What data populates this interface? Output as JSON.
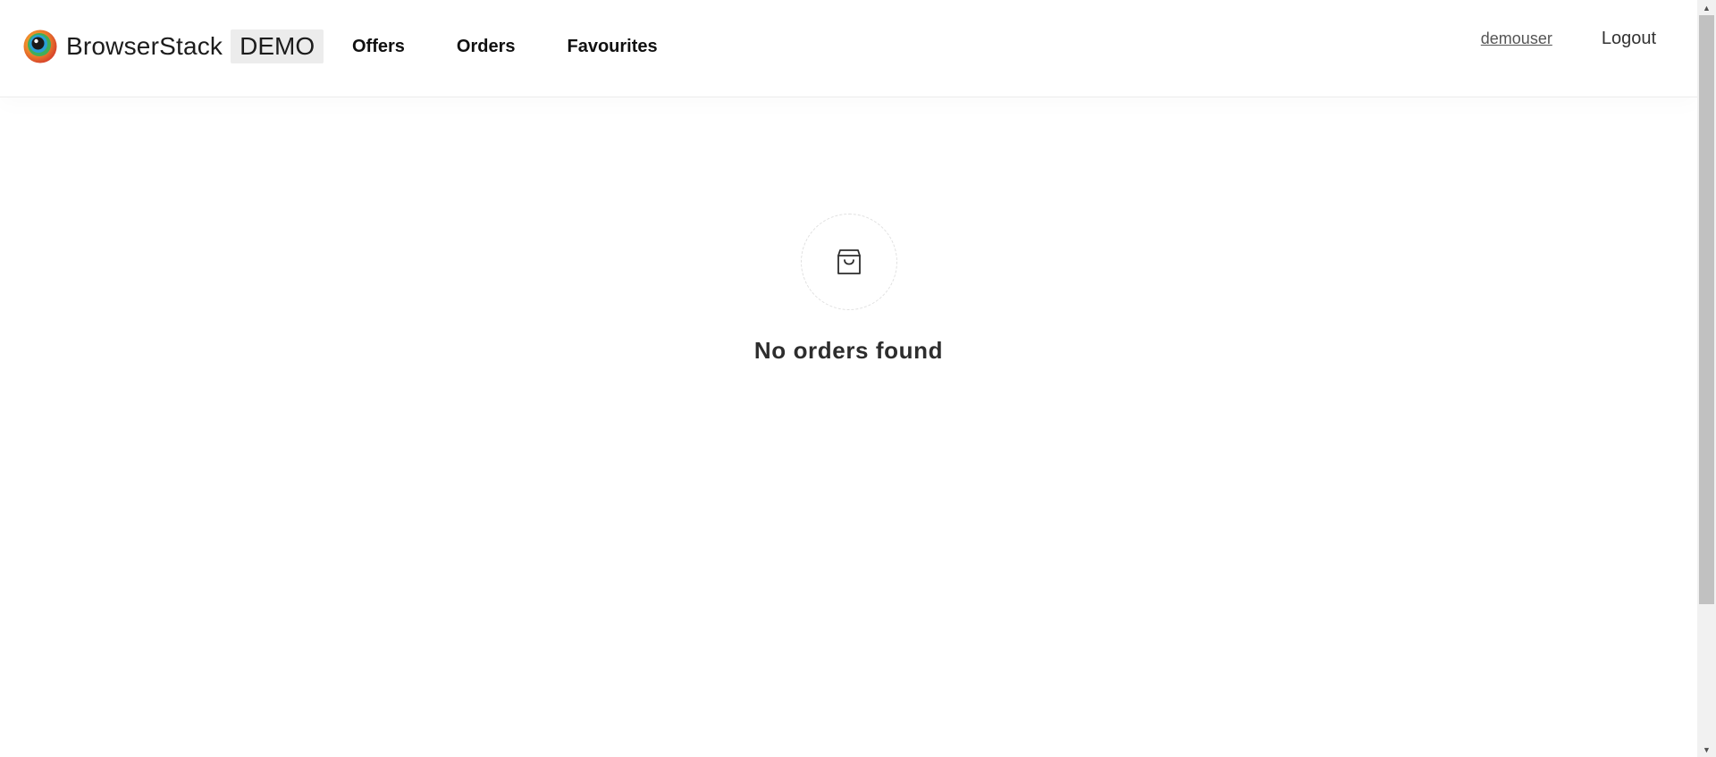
{
  "navbar": {
    "brand": {
      "name": "BrowserStack",
      "tag": "DEMO",
      "logo_icon": "browserstack-logo-icon"
    },
    "links": [
      {
        "label": "Offers"
      },
      {
        "label": "Orders"
      },
      {
        "label": "Favourites"
      }
    ],
    "username": "demouser",
    "logout_label": "Logout"
  },
  "empty_state": {
    "icon": "shopping-bag-icon",
    "title": "No orders found"
  },
  "colors": {
    "brand_tag_bg": "#ececec",
    "text_dark": "#2d2d2d",
    "scrollbar_thumb": "#c1c1c1"
  }
}
